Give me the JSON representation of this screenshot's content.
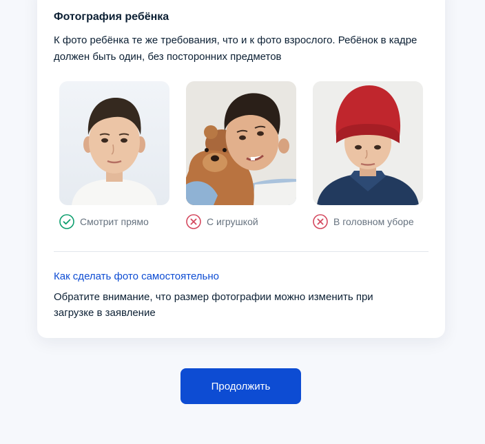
{
  "section": {
    "title": "Фотография ребёнка",
    "description": "К фото ребёнка те же требования, что и к фото взрослого. Ребёнок в кадре должен быть один, без посторонних предметов"
  },
  "examples": [
    {
      "label": "Смотрит прямо",
      "status": "correct",
      "icon": "check-circle-icon",
      "color": "#0c9e6e"
    },
    {
      "label": "С игрушкой",
      "status": "incorrect",
      "icon": "cross-circle-icon",
      "color": "#d4485e"
    },
    {
      "label": "В головном уборе",
      "status": "incorrect",
      "icon": "cross-circle-icon",
      "color": "#d4485e"
    }
  ],
  "help": {
    "link_text": "Как сделать фото самостоятельно",
    "note": "Обратите внимание, что размер фотографии можно изменить при загрузке в заявление"
  },
  "actions": {
    "continue_label": "Продолжить"
  },
  "colors": {
    "accent": "#0d4cd3",
    "success": "#0c9e6e",
    "error": "#d4485e",
    "background": "#f6f8fc"
  }
}
